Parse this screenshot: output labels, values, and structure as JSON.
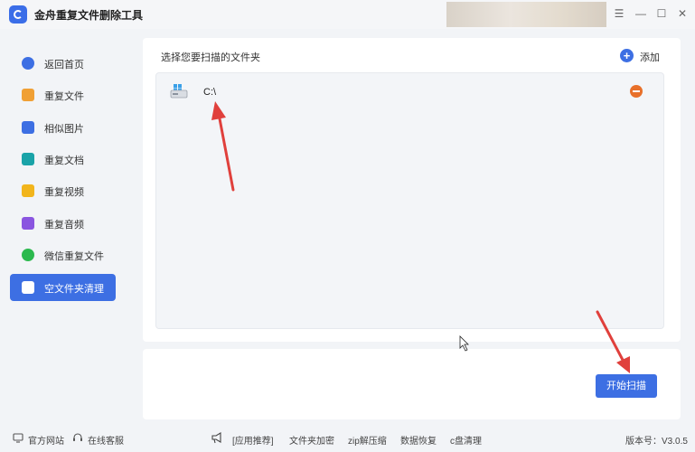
{
  "app": {
    "title": "金舟重复文件删除工具"
  },
  "window_controls": {
    "menu": "☰",
    "minimize": "—",
    "maximize": "☐",
    "close": "✕"
  },
  "sidebar": {
    "items": [
      {
        "label": "返回首页",
        "icon": "home-icon",
        "color": "#3d6fe3"
      },
      {
        "label": "重复文件",
        "icon": "folder-icon",
        "color": "#f0a035"
      },
      {
        "label": "相似图片",
        "icon": "image-icon",
        "color": "#3d6fe3"
      },
      {
        "label": "重复文档",
        "icon": "document-icon",
        "color": "#1aa3a8"
      },
      {
        "label": "重复视频",
        "icon": "video-icon",
        "color": "#f2b51c"
      },
      {
        "label": "重复音频",
        "icon": "audio-icon",
        "color": "#8a55e0"
      },
      {
        "label": "微信重复文件",
        "icon": "wechat-icon",
        "color": "#2cb94e"
      },
      {
        "label": "空文件夹清理",
        "icon": "empty-folder-icon",
        "color": "#ffffff",
        "active": true
      }
    ]
  },
  "main": {
    "section_title": "选择您要扫描的文件夹",
    "add_label": "添加",
    "folders": [
      {
        "path": "C:\\"
      }
    ],
    "scan_button": "开始扫描"
  },
  "footer": {
    "official_site": "官方网站",
    "online_service": "在线客服",
    "app_recommend": "[应用推荐]",
    "folder_encrypt": "文件夹加密",
    "zip_tool": "zip解压缩",
    "data_recovery": "数据恢复",
    "disk_clean": "c盘清理",
    "version": "版本号：V3.0.5"
  },
  "colors": {
    "accent": "#3d6fe3",
    "remove": "#e8702a",
    "annotation_arrow": "#e0403c"
  }
}
